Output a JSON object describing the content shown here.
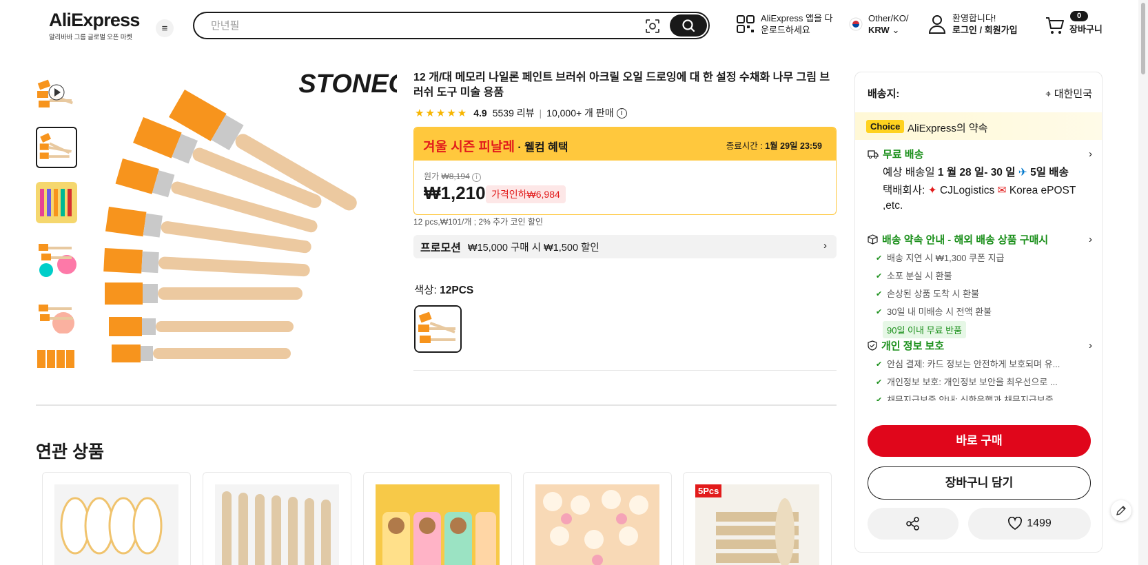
{
  "header": {
    "logo_text": "AliExpress",
    "logo_tagline": "알리바바 그룹 글로벌 오픈 마켓",
    "search_placeholder": "만년필",
    "app_download_line1": "AliExpress 앱을 다",
    "app_download_line2": "운로드하세요",
    "locale_line1": "Other/KO/",
    "locale_currency": "KRW",
    "welcome_line1": "환영합니다!",
    "welcome_line2": "로그인 / 회원가입",
    "cart_count": "0",
    "cart_label": "장바구니"
  },
  "product": {
    "title": "12 개/대 메모리 나일론 페인트 브러쉬 아크릴 오일 드로잉에 대 한 설정 수채화 나무 그림 브러쉬 도구 미술 용품",
    "brand_watermark": "STONEGO",
    "rating": "4.9",
    "reviews": "5539 리뷰",
    "sold": "10,000+ 개 판매",
    "rating_stars": 5,
    "promo_title": "겨울 시즌 피날레",
    "promo_sub": " · 웰컴 혜택",
    "promo_end_label": "종료시간 : ",
    "promo_end_time": "1월 29일 23:59",
    "orig_label": "원가 ",
    "orig_price": "₩8,194",
    "price": "₩1,210",
    "discount": "가격인하₩6,984",
    "coins_note": "12 pcs,₩101/개 ; 2% 추가 코인 할인",
    "promotion_label": "프로모션",
    "promotion_text": "₩15,000 구매 시 ₩1,500 할인",
    "color_label": "색상: ",
    "color_value": "12PCS"
  },
  "related": {
    "title": "연관 상품",
    "badge": "5Pcs"
  },
  "panel": {
    "ship_to_label": "배송지:",
    "ship_to_value": "대한민국",
    "choice_tag": "Choice",
    "choice_text": "AliExpress의 약속",
    "free_shipping": "무료 배송",
    "est_label": "예상 배송일 ",
    "est_dates": "1 월 28 일- 30 일",
    "est_days": "5일 배송",
    "carrier_label": "택배회사: ",
    "carrier_text": "CJLogistics",
    "carrier_text2": "Korea ePOST ,etc.",
    "guarantee_head": "배송 약속 안내 - 해외 배송 상품 구매시",
    "guarantee_items": [
      "배송 지연 시 ₩1,300 쿠폰 지급",
      "소포 분실 시 환불",
      "손상된 상품 도착 시 환불",
      "30일 내 미배송 시 전액 환불"
    ],
    "free_return": "90일 이내 무료 반품",
    "privacy_head": "개인 정보 보호",
    "privacy_items": [
      "안심 결제: 카드 정보는 안전하게 보호되며 유...",
      "개인정보 보호: 개인정보 보안을 최우선으로 ...",
      "채무지급보증 안내: 신한은행과 채무지급보증..."
    ],
    "buy_now": "바로 구매",
    "add_to_cart": "장바구니 담기",
    "wishlist_count": "1499"
  },
  "colors": {
    "accent_red": "#e0061b",
    "promo_yellow": "#ffc83d",
    "green": "#1a8f1a",
    "brush_orange": "#f7941d"
  }
}
